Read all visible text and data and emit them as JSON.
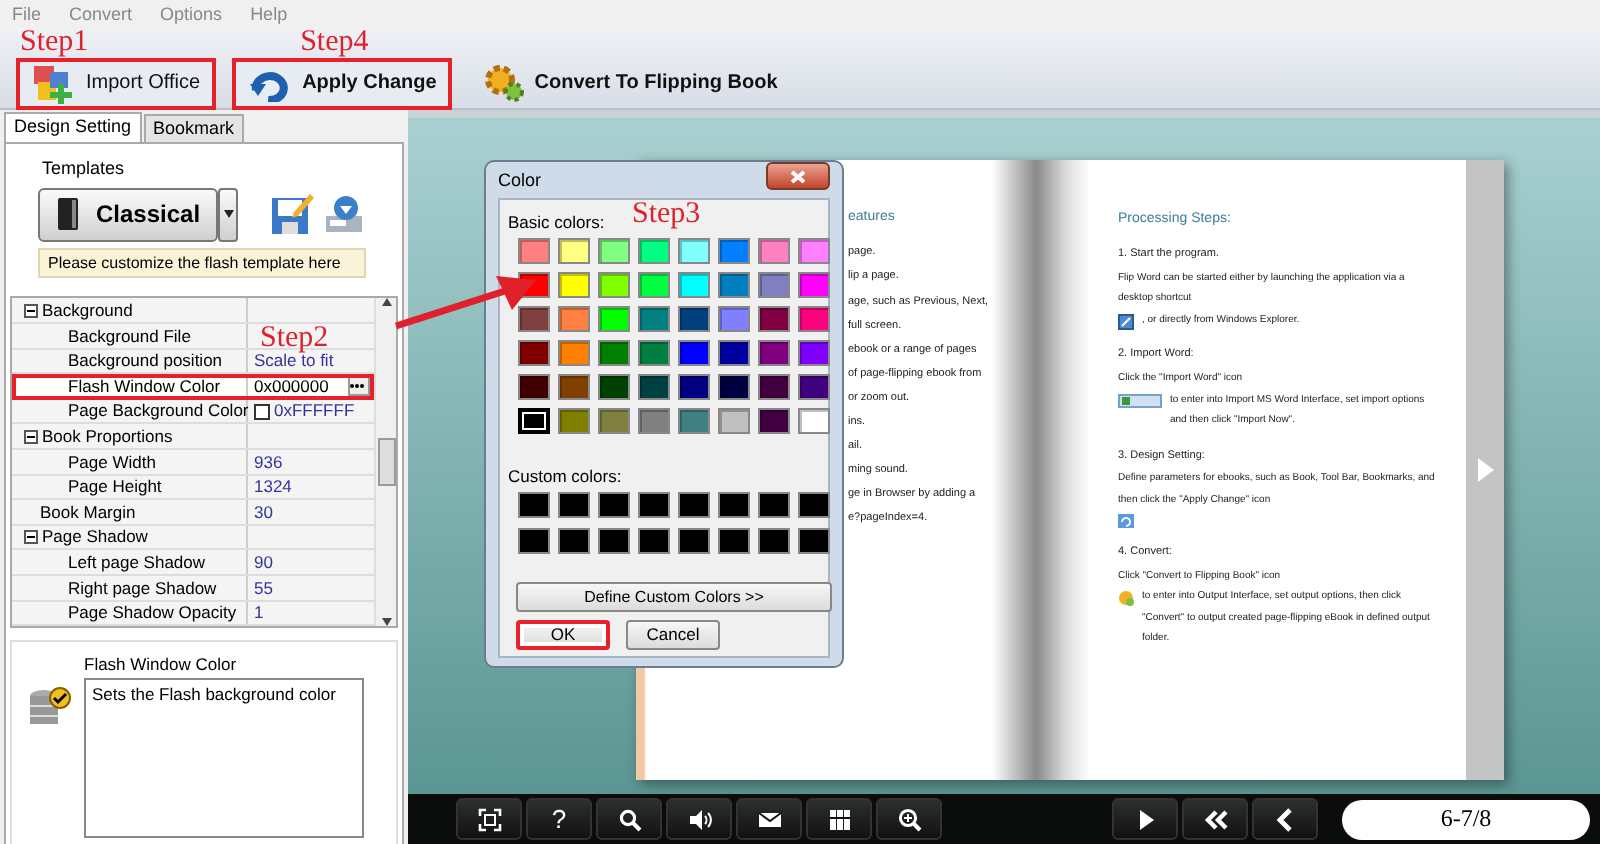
{
  "menu": [
    "File",
    "Convert",
    "Options",
    "Help"
  ],
  "toolbar": [
    {
      "kind": "import",
      "label": "Import Office",
      "highlighted": true,
      "step": "Step1"
    },
    {
      "kind": "apply",
      "label": "Apply Change",
      "highlighted": true,
      "step": "Step4"
    },
    {
      "kind": "convert",
      "label": "Convert To Flipping Book",
      "highlighted": false
    }
  ],
  "tabs": [
    {
      "label": "Design Setting",
      "selected": true
    },
    {
      "label": "Bookmark",
      "selected": false
    }
  ],
  "templates": {
    "title": "Templates",
    "template": "Classical",
    "hint": "Please customize the flash template here"
  },
  "properties": [
    {
      "kind": "category",
      "name": "Background",
      "expanded": true,
      "children": [
        {
          "kind": "text",
          "name": "Background File"
        },
        {
          "kind": "text",
          "name": "Background position",
          "value": "Scale to fit"
        },
        {
          "kind": "text",
          "name": "Flash Window Color",
          "value": "0x000000",
          "selected": true,
          "highlighted": true,
          "step": "Step2"
        },
        {
          "kind": "color",
          "name": "Page Background Color",
          "value": "0xFFFFFF"
        }
      ]
    },
    {
      "kind": "category",
      "name": "Book Proportions",
      "expanded": true,
      "children": [
        {
          "kind": "text",
          "name": "Page Width",
          "value": "936"
        },
        {
          "kind": "text",
          "name": "Page Height",
          "value": "1324"
        }
      ]
    },
    {
      "kind": "text",
      "name": "Book Margin",
      "value": "30"
    },
    {
      "kind": "category",
      "name": "Page Shadow",
      "expanded": true,
      "children": [
        {
          "kind": "text",
          "name": "Left page Shadow",
          "value": "90"
        },
        {
          "kind": "text",
          "name": "Right page Shadow",
          "value": "55"
        },
        {
          "kind": "text",
          "name": "Page Shadow Opacity",
          "value": "1"
        }
      ]
    }
  ],
  "description": {
    "title": "Flash Window Color",
    "text": "Sets the Flash background color"
  },
  "book": {
    "left_page": {
      "heading": "eatures",
      "lines": [
        "page.",
        "lip a page.",
        "age, such as Previous, Next,",
        "full screen.",
        "ebook or a range of pages",
        "of page-flipping ebook from",
        "or zoom out.",
        "ins.",
        "ail.",
        "ming sound.",
        "ge in Browser by adding a",
        "e?pageIndex=4."
      ]
    },
    "right_page": {
      "heading": "Processing Steps:",
      "steps": [
        {
          "title": "1. Start the program.",
          "text_before": "Flip Word can be started either by launching the application via a desktop shortcut",
          "text_after": ", or directly from Windows Explorer."
        },
        {
          "title": "2. Import Word:",
          "text_before": "Click the \"Import Word\" icon",
          "text_after": "to enter into Import MS Word Interface, set import options and then click \"Import Now\"."
        },
        {
          "title": "3. Design Setting:",
          "text_before": "Define parameters for ebooks, such as Book, Tool Bar, Bookmarks, and then click the \"Apply Change\" icon"
        },
        {
          "title": "4. Convert:",
          "text_before": "Click \"Convert to Flipping Book\" icon",
          "text_after": "to enter into Output Interface, set output options, then click \"Convert\" to output created page-flipping eBook in defined output folder."
        }
      ]
    }
  },
  "dialog": {
    "title": "Color",
    "step": "Step3",
    "basic_label": "Basic colors:",
    "basic_colors": [
      {
        "color": "#ff8080",
        "selected": false
      },
      {
        "color": "#ffff80",
        "selected": false
      },
      {
        "color": "#80ff80",
        "selected": false
      },
      {
        "color": "#00ff80",
        "selected": false
      },
      {
        "color": "#80ffff",
        "selected": false
      },
      {
        "color": "#0080ff",
        "selected": false
      },
      {
        "color": "#ff80c0",
        "selected": false
      },
      {
        "color": "#ff80ff",
        "selected": false
      },
      {
        "color": "#ff0000",
        "selected": false
      },
      {
        "color": "#ffff00",
        "selected": false
      },
      {
        "color": "#80ff00",
        "selected": false
      },
      {
        "color": "#00ff40",
        "selected": false
      },
      {
        "color": "#00ffff",
        "selected": false
      },
      {
        "color": "#0080c0",
        "selected": false
      },
      {
        "color": "#8080c0",
        "selected": false
      },
      {
        "color": "#ff00ff",
        "selected": false
      },
      {
        "color": "#804040",
        "selected": false
      },
      {
        "color": "#ff8040",
        "selected": false
      },
      {
        "color": "#00ff00",
        "selected": false
      },
      {
        "color": "#008080",
        "selected": false
      },
      {
        "color": "#004080",
        "selected": false
      },
      {
        "color": "#8080ff",
        "selected": false
      },
      {
        "color": "#800040",
        "selected": false
      },
      {
        "color": "#ff0080",
        "selected": false
      },
      {
        "color": "#800000",
        "selected": false
      },
      {
        "color": "#ff8000",
        "selected": false
      },
      {
        "color": "#008000",
        "selected": false
      },
      {
        "color": "#008040",
        "selected": false
      },
      {
        "color": "#0000ff",
        "selected": false
      },
      {
        "color": "#0000a0",
        "selected": false
      },
      {
        "color": "#800080",
        "selected": false
      },
      {
        "color": "#8000ff",
        "selected": false
      },
      {
        "color": "#400000",
        "selected": false
      },
      {
        "color": "#804000",
        "selected": false
      },
      {
        "color": "#004000",
        "selected": false
      },
      {
        "color": "#004040",
        "selected": false
      },
      {
        "color": "#000080",
        "selected": false
      },
      {
        "color": "#000040",
        "selected": false
      },
      {
        "color": "#400040",
        "selected": false
      },
      {
        "color": "#400080",
        "selected": false
      },
      {
        "color": "#000000",
        "selected": true
      },
      {
        "color": "#808000",
        "selected": false
      },
      {
        "color": "#808040",
        "selected": false
      },
      {
        "color": "#808080",
        "selected": false
      },
      {
        "color": "#408080",
        "selected": false
      },
      {
        "color": "#c0c0c0",
        "selected": false
      },
      {
        "color": "#400040",
        "selected": false
      },
      {
        "color": "#ffffff",
        "selected": false
      }
    ],
    "custom_label": "Custom colors:",
    "custom_colors": [
      {
        "color": "#000000"
      },
      {
        "color": "#000000"
      },
      {
        "color": "#000000"
      },
      {
        "color": "#000000"
      },
      {
        "color": "#000000"
      },
      {
        "color": "#000000"
      },
      {
        "color": "#000000"
      },
      {
        "color": "#000000"
      },
      {
        "color": "#000000"
      },
      {
        "color": "#000000"
      },
      {
        "color": "#000000"
      },
      {
        "color": "#000000"
      },
      {
        "color": "#000000"
      },
      {
        "color": "#000000"
      },
      {
        "color": "#000000"
      },
      {
        "color": "#000000"
      }
    ],
    "define_button": "Define Custom Colors >>",
    "buttons": [
      {
        "label": "OK",
        "highlighted": true
      },
      {
        "label": "Cancel",
        "highlighted": false
      }
    ]
  },
  "player": {
    "tools": [
      {
        "kind": "fit"
      },
      {
        "label": "?"
      },
      {
        "kind": "search"
      },
      {
        "kind": "sound"
      },
      {
        "kind": "mail"
      },
      {
        "kind": "thumbnails"
      },
      {
        "kind": "zoom"
      }
    ],
    "nav": [
      {
        "kind": "play"
      },
      {
        "kind": "first"
      },
      {
        "kind": "prev"
      }
    ],
    "page": "6-7/8"
  }
}
